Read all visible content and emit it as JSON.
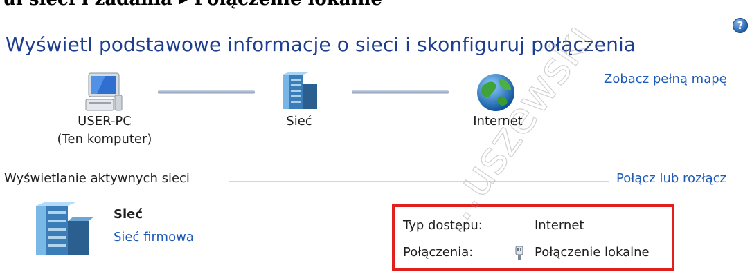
{
  "breadcrumb": "ul sieci i zadania  ▸  Połączenie lokalne",
  "help": {
    "glyph": "?"
  },
  "page_title": "Wyświetl podstawowe informacje o sieci i skonfiguruj połączenia",
  "view_full_map": "Zobacz pełną mapę",
  "map": {
    "computer": {
      "name": "USER-PC",
      "sub": "(Ten komputer)"
    },
    "network": {
      "name": "Sieć"
    },
    "internet": {
      "name": "Internet"
    }
  },
  "active_networks": {
    "heading": "Wyświetlanie aktywnych sieci",
    "connect_link": "Połącz lub rozłącz",
    "network_name": "Sieć",
    "network_type": "Sieć firmowa",
    "access_type_label": "Typ dostępu:",
    "access_type_value": "Internet",
    "connections_label": "Połączenia:",
    "connections_value": "Połączenie lokalne"
  },
  "watermark": "...uszewski",
  "colors": {
    "title": "#1e3f8f",
    "link": "#1e5bb8",
    "highlight": "#e0201f"
  }
}
